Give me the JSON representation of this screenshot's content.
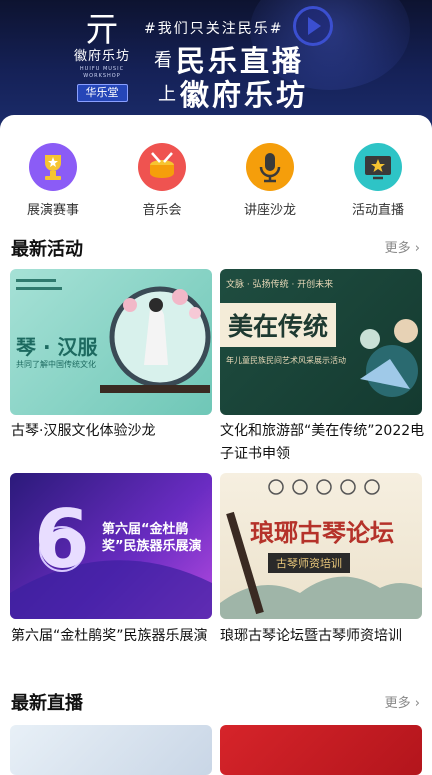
{
  "banner": {
    "logo_mark": "亓",
    "logo_brand": "徽府乐坊",
    "logo_sub": "HUIFU MUSIC WORKSHOP",
    "logo_tag": "华乐堂",
    "slogan": "#我们只关注民乐#",
    "line1_small": "看",
    "line1_big": "民乐直播",
    "line2_small": "上",
    "line2_big": "徽府乐坊"
  },
  "categories": [
    {
      "label": "展演赛事",
      "icon": "trophy-icon",
      "color": "#8b5cf6"
    },
    {
      "label": "音乐会",
      "icon": "drum-icon",
      "color": "#ef5350"
    },
    {
      "label": "讲座沙龙",
      "icon": "microphone-icon",
      "color": "#f59e0b"
    },
    {
      "label": "活动直播",
      "icon": "tv-star-icon",
      "color": "#2ec4c6"
    }
  ],
  "latest_activities": {
    "title": "最新活动",
    "more": "更多",
    "items": [
      {
        "title": "古琴·汉服文化体验沙龙",
        "poster_text": "琴 · 汉服",
        "poster_sub": "共同了解中国传统文化"
      },
      {
        "title": "文化和旅游部“美在传统”2022电子证书申领",
        "poster_text": "美在传统",
        "poster_top": "文脉 · 弘扬传统 · 开创未来",
        "poster_sub": "年儿童民族民间艺术风采展示活动"
      },
      {
        "title": "第六届“金杜鹃奖”民族器乐展演",
        "poster_text": "第六届“金杜鹃奖”民族器乐展演",
        "poster_num": "6"
      },
      {
        "title": "琅琊古琴论坛暨古琴师资培训",
        "poster_text": "琅琊古琴论坛",
        "poster_sub": "古琴师资培训"
      }
    ]
  },
  "latest_live": {
    "title": "最新直播",
    "more": "更多"
  }
}
